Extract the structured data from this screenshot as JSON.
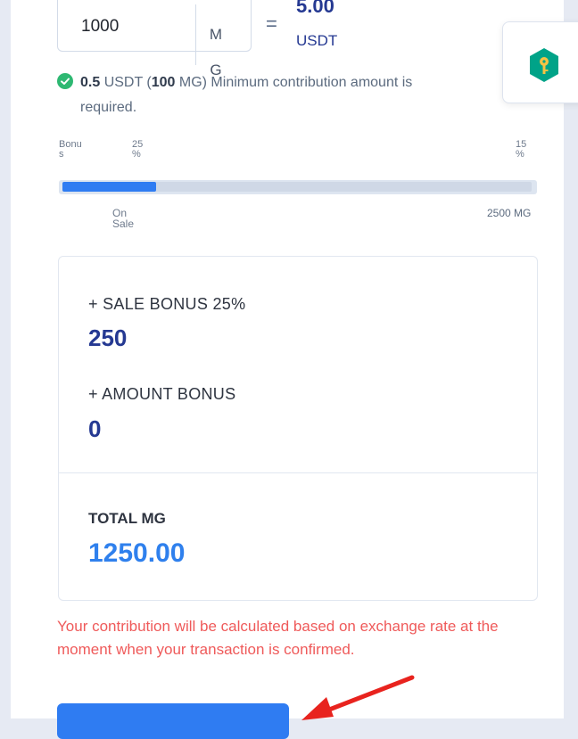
{
  "amount_input": {
    "value": "1000",
    "unit": "MG"
  },
  "conversion": {
    "equals": "=",
    "value": "5.00",
    "currency": "USDT"
  },
  "key_widget": {
    "icon": "key-icon",
    "color": "#00a388"
  },
  "min_note": {
    "icon": "check-circle-icon",
    "amount": "0.5",
    "text_line1": " USDT (",
    "amount_mg": "100",
    "text_line1b": " MG) Minimum contribution amount is",
    "text_line2": "required."
  },
  "bonus_scale": {
    "left_label": "Bonus",
    "tier1_percent": "25 %",
    "tier2_percent": "15 %",
    "on_sale_label": "On Sale",
    "max_label": "2500 MG",
    "progress_fraction": 0.2,
    "fill_color": "#2f7cf2"
  },
  "bonus_card": {
    "sale_bonus_label": "+ SALE BONUS 25%",
    "sale_bonus_value": "250",
    "amount_bonus_label": "+ AMOUNT BONUS",
    "amount_bonus_value": "0",
    "total_label": "TOTAL MG",
    "total_value": "1250.00"
  },
  "rate_note": "Your contribution will be calculated based on exchange rate at the moment when your transaction is confirmed.",
  "buy_button": {
    "label": "",
    "color": "#2f7cf2"
  },
  "arrow": {
    "color": "#e8231e"
  }
}
